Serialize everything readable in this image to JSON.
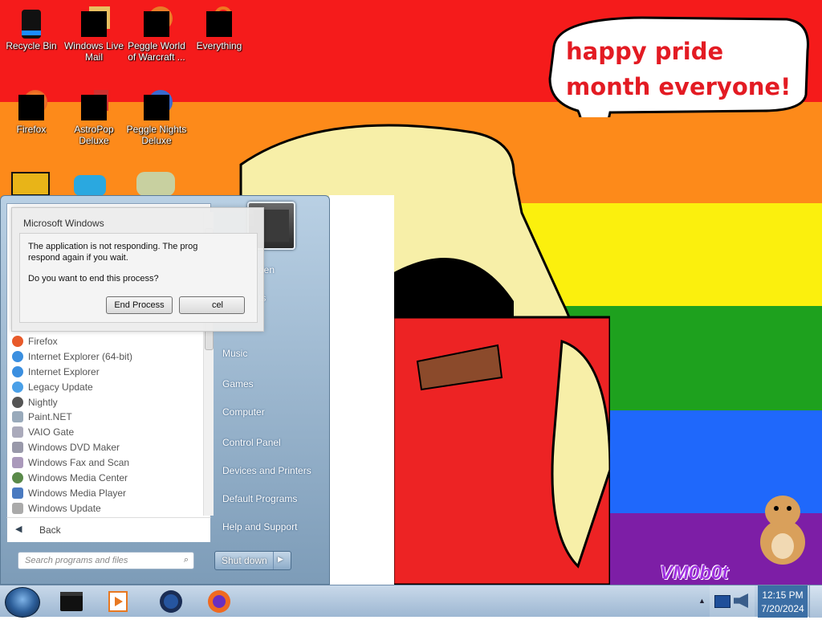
{
  "colors": {
    "stripes": [
      "#f51b1b",
      "#fd8a1a",
      "#fbf00d",
      "#1ea11e",
      "#1f68fb",
      "#7d1ea6"
    ],
    "speech_text": "#e31b23"
  },
  "desktop": {
    "icons": [
      {
        "label": "Recycle Bin",
        "icon": "recycle-bin-icon"
      },
      {
        "label": "Windows Live Mail",
        "icon": "windows-live-mail-icon"
      },
      {
        "label": "Peggle World of Warcraft ...",
        "icon": "peggle-wow-icon"
      },
      {
        "label": "Everything",
        "icon": "everything-search-icon"
      },
      {
        "label": "Firefox",
        "icon": "firefox-icon"
      },
      {
        "label": "AstroPop Deluxe",
        "icon": "astropop-icon"
      },
      {
        "label": "Peggle Nights Deluxe",
        "icon": "peggle-nights-icon"
      }
    ],
    "speech_bubble": "happy pride month everyone!",
    "watermark": "VM0b0t"
  },
  "start_menu": {
    "programs": [
      "Firefox",
      "Internet Explorer (64-bit)",
      "Internet Explorer",
      "Legacy Update",
      "Nightly",
      "Paint.NET",
      "VAIO Gate",
      "Windows DVD Maker",
      "Windows Fax and Scan",
      "Windows Media Center",
      "Windows Media Player",
      "Windows Update"
    ],
    "back_label": "Back",
    "search_placeholder": "Search programs and files",
    "right_items": [
      "Music",
      "Games",
      "Computer",
      "Control Panel",
      "Devices and Printers",
      "Default Programs",
      "Help and Support"
    ],
    "right_partial": [
      "den",
      "ts"
    ],
    "shutdown_label": "Shut down"
  },
  "dialog": {
    "title": "Microsoft Windows",
    "line1": "The application is not responding. The prog",
    "line2": "respond again if you wait.",
    "question": "Do you want to end this process?",
    "end_process": "End Process",
    "cancel": "cel"
  },
  "taskbar": {
    "pinned": [
      "cmd-icon",
      "media-player-icon",
      "vpn-globe-icon",
      "firefox-icon"
    ],
    "time": "12:15 PM",
    "date": "7/20/2024"
  }
}
